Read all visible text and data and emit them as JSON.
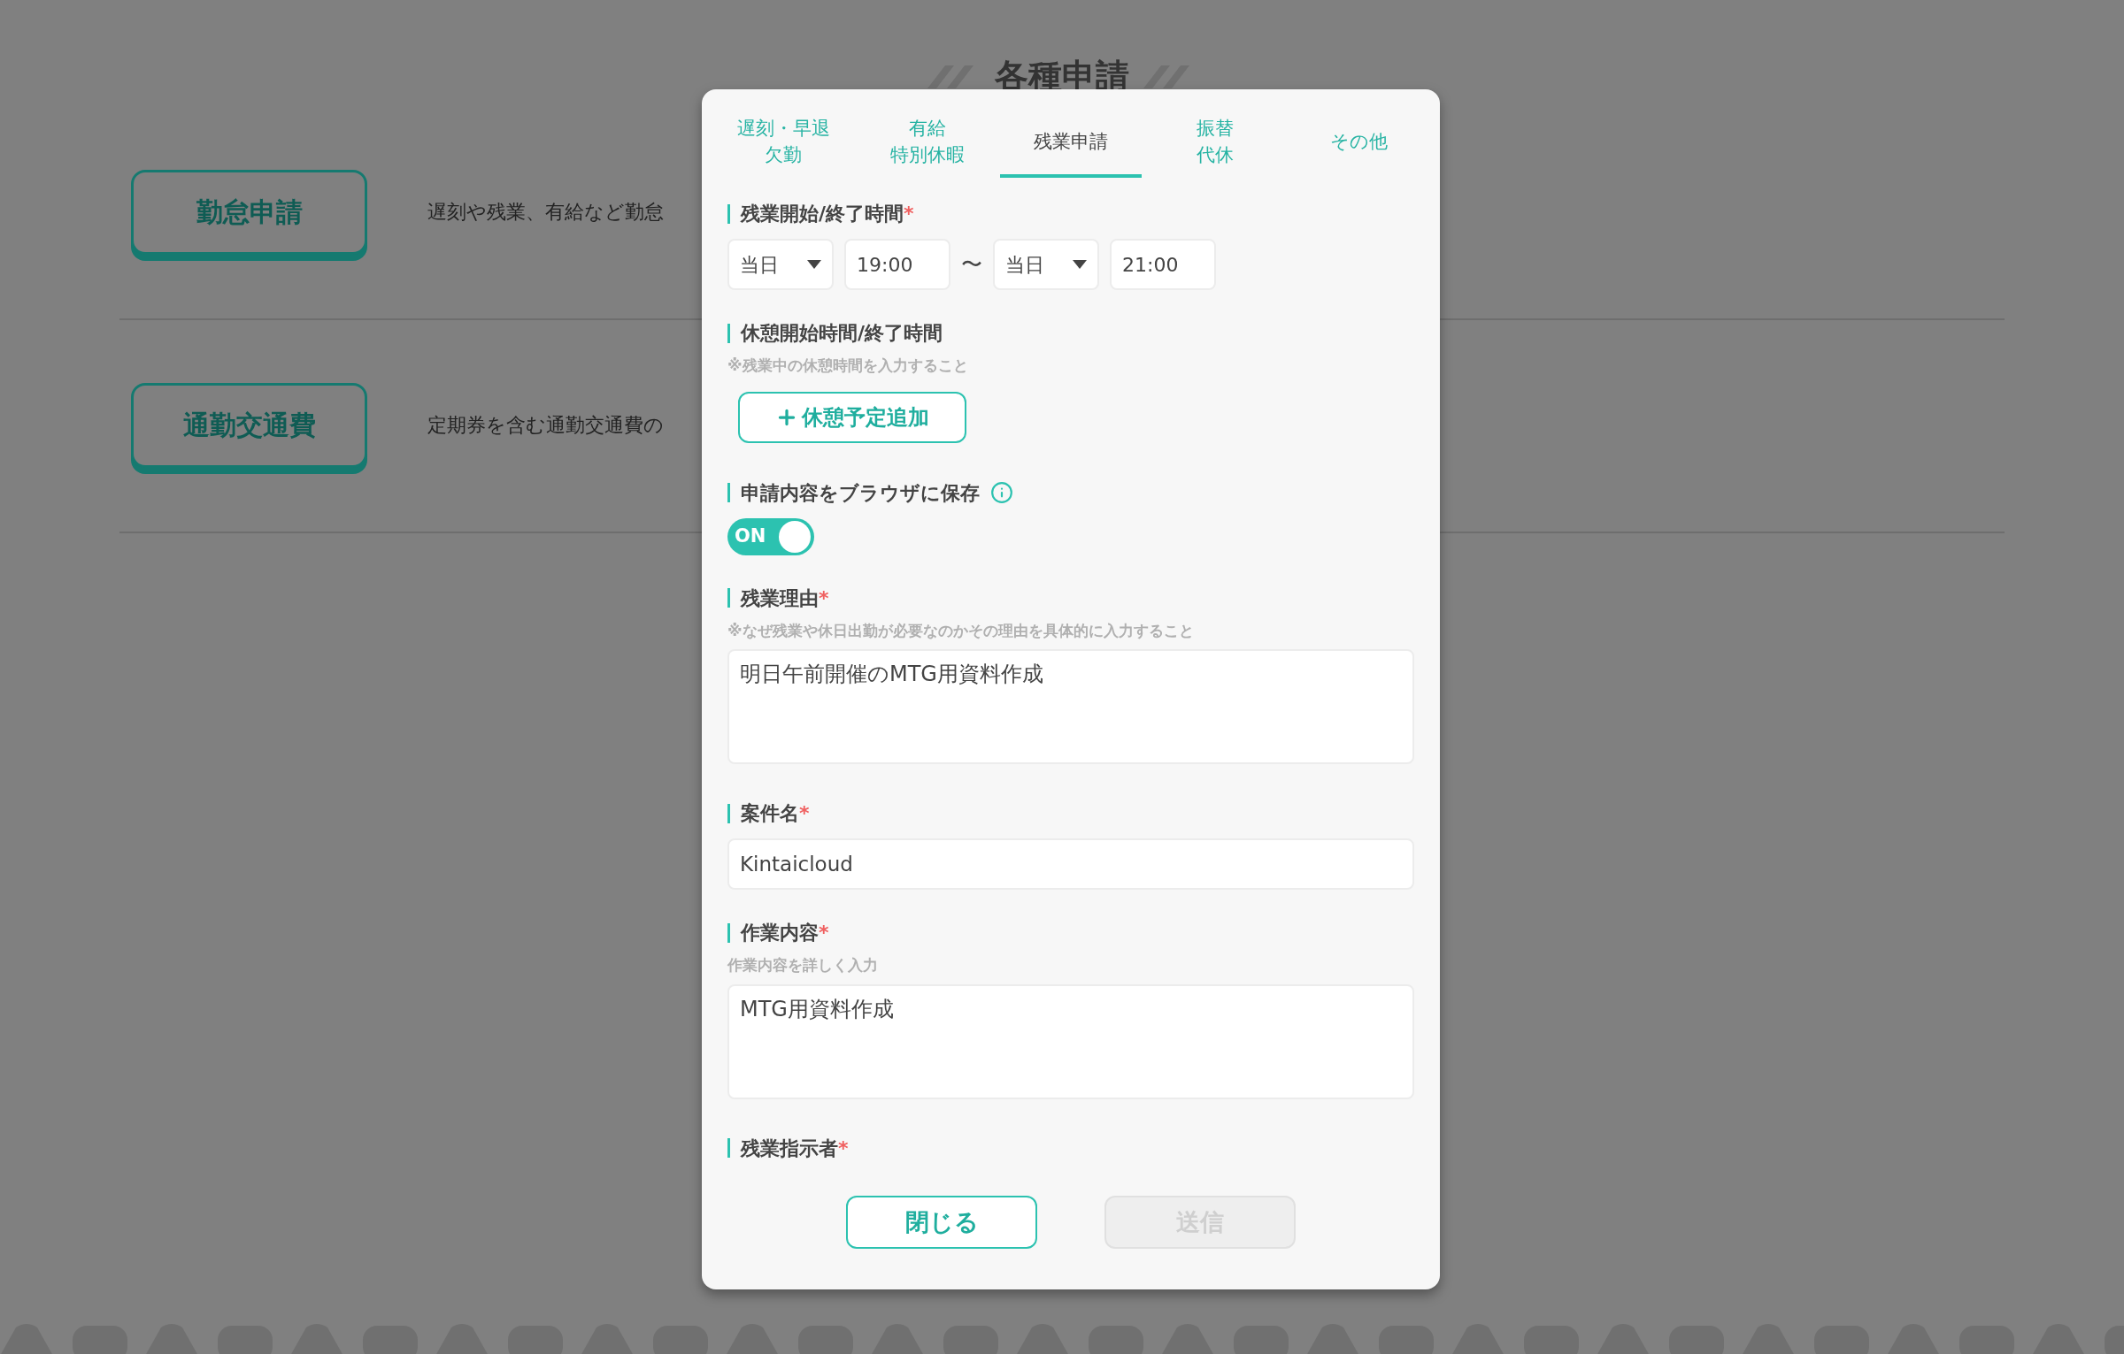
{
  "page": {
    "title": "各種申請",
    "items": [
      {
        "button": "勤怠申請",
        "description": "遅刻や残業、有給など勤怠"
      },
      {
        "button": "通勤交通費",
        "description": "定期券を含む通勤交通費の"
      }
    ]
  },
  "dialog": {
    "tabs": [
      {
        "lines": [
          "遅刻・早退",
          "欠勤"
        ],
        "selected": false
      },
      {
        "lines": [
          "有給",
          "特別休暇"
        ],
        "selected": false
      },
      {
        "lines": [
          "残業申請"
        ],
        "selected": true
      },
      {
        "lines": [
          "振替",
          "代休"
        ],
        "selected": false
      },
      {
        "lines": [
          "その他"
        ],
        "selected": false
      }
    ],
    "fields": [
      {
        "kind": "time_range",
        "label": "残業開始/終了時間",
        "mark": "*",
        "start_day": "当日",
        "start_time": "19:00",
        "separator": "〜",
        "end_day": "当日",
        "end_time": "21:00"
      },
      {
        "kind": "add_button",
        "label": "休憩開始時間/終了時間",
        "hint": "※残業中の休憩時間を入力すること",
        "button": "休憩予定追加"
      },
      {
        "kind": "toggle",
        "label": "申請内容をブラウザに保存",
        "info": true,
        "on": true,
        "state_text": "ON"
      },
      {
        "kind": "textarea",
        "label": "残業理由",
        "mark": "*",
        "hint": "※なぜ残業や休日出勤が必要なのかその理由を具体的に入力すること",
        "value": "明日午前開催のMTG用資料作成"
      },
      {
        "kind": "input",
        "label": "案件名",
        "mark": "*",
        "value": "Kintaicloud"
      },
      {
        "kind": "textarea",
        "label": "作業内容",
        "mark": "*",
        "hint": "作業内容を詳しく入力",
        "value": "MTG用資料作成"
      },
      {
        "kind": "label_only",
        "label": "残業指示者",
        "mark": "*"
      }
    ],
    "buttons": [
      {
        "label": "閉じる",
        "disabled": false
      },
      {
        "label": "送信",
        "disabled": true
      }
    ]
  }
}
